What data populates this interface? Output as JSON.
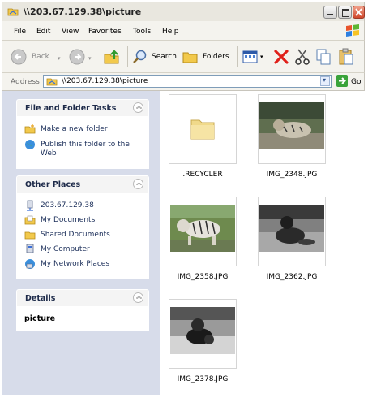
{
  "window": {
    "title": "\\\\203.67.129.38\\picture"
  },
  "menu": [
    "File",
    "Edit",
    "View",
    "Favorites",
    "Tools",
    "Help"
  ],
  "toolbar": {
    "back": "Back",
    "search": "Search",
    "folders": "Folders"
  },
  "address": {
    "label": "Address",
    "value": "\\\\203.67.129.38\\picture",
    "go": "Go"
  },
  "tasks": {
    "title": "File and Folder Tasks",
    "items": [
      "Make a new folder",
      "Publish this folder to the Web"
    ]
  },
  "other_places": {
    "title": "Other Places",
    "items": [
      "203.67.129.38",
      "My Documents",
      "Shared Documents",
      "My Computer",
      "My Network Places"
    ]
  },
  "details": {
    "title": "Details",
    "name": "picture"
  },
  "files": [
    ".RECYCLER",
    "IMG_2348.JPG",
    "IMG_2358.JPG",
    "IMG_2362.JPG",
    "IMG_2378.JPG"
  ],
  "colors": {
    "accent": "#1c2f5a",
    "close": "#d0472b",
    "go": "#3aa33a"
  }
}
